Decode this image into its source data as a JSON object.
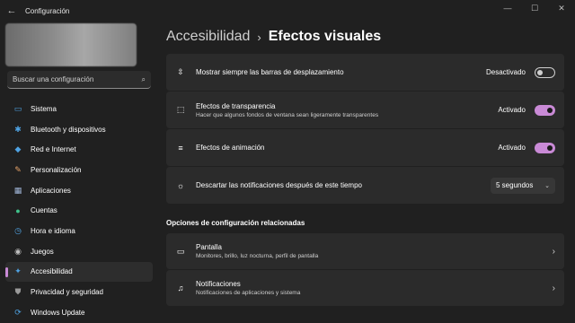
{
  "window": {
    "title": "Configuración",
    "back_glyph": "←",
    "controls": {
      "minimize": "—",
      "maximize": "☐",
      "close": "✕"
    }
  },
  "search": {
    "placeholder": "Buscar una configuración",
    "icon": "search-icon",
    "icon_glyph": "⌕"
  },
  "sidebar": {
    "items": [
      {
        "label": "Sistema",
        "icon": "monitor-icon",
        "glyph": "▭",
        "color": "#4fa3e3"
      },
      {
        "label": "Bluetooth y dispositivos",
        "icon": "bluetooth-icon",
        "glyph": "✱",
        "color": "#4fa3e3"
      },
      {
        "label": "Red e Internet",
        "icon": "wifi-icon",
        "glyph": "◆",
        "color": "#4fa3e3"
      },
      {
        "label": "Personalización",
        "icon": "brush-icon",
        "glyph": "✎",
        "color": "#e8a46a"
      },
      {
        "label": "Aplicaciones",
        "icon": "apps-icon",
        "glyph": "▦",
        "color": "#9fb4d6"
      },
      {
        "label": "Cuentas",
        "icon": "account-icon",
        "glyph": "●",
        "color": "#3fc38b"
      },
      {
        "label": "Hora e idioma",
        "icon": "globe-clock-icon",
        "glyph": "◷",
        "color": "#4fa3e3"
      },
      {
        "label": "Juegos",
        "icon": "gamepad-icon",
        "glyph": "◉",
        "color": "#bdbdbd"
      },
      {
        "label": "Accesibilidad",
        "icon": "accessibility-icon",
        "glyph": "✦",
        "color": "#4fa3e3",
        "active": true
      },
      {
        "label": "Privacidad y seguridad",
        "icon": "shield-icon",
        "glyph": "⛊",
        "color": "#9a9a9a"
      },
      {
        "label": "Windows Update",
        "icon": "update-icon",
        "glyph": "⟳",
        "color": "#4fa3e3"
      }
    ]
  },
  "breadcrumb": {
    "parent": "Accesibilidad",
    "separator": "›",
    "current": "Efectos visuales"
  },
  "settings": {
    "scrollbars": {
      "title": "Mostrar siempre las barras de desplazamiento",
      "state_label": "Desactivado",
      "on": false,
      "icon": "scrollbar-icon",
      "glyph": "⇳"
    },
    "transparency": {
      "title": "Efectos de transparencia",
      "subtitle": "Hacer que algunos fondos de ventana sean ligeramente transparentes",
      "state_label": "Activado",
      "on": true,
      "icon": "transparency-icon",
      "glyph": "⬚"
    },
    "animation": {
      "title": "Efectos de animación",
      "state_label": "Activado",
      "on": true,
      "icon": "animation-icon",
      "glyph": "≡"
    },
    "notifications_timeout": {
      "title": "Descartar las notificaciones después de este tiempo",
      "value": "5 segundos",
      "icon": "brightness-icon",
      "glyph": "☼"
    }
  },
  "related": {
    "heading": "Opciones de configuración relacionadas",
    "items": [
      {
        "title": "Pantalla",
        "subtitle": "Monitores, brillo, luz nocturna, perfil de pantalla",
        "icon": "display-icon",
        "glyph": "▭"
      },
      {
        "title": "Notificaciones",
        "subtitle": "Notificaciones de aplicaciones y sistema",
        "icon": "bell-icon",
        "glyph": "♫"
      }
    ]
  },
  "colors": {
    "accent": "#c98ad6",
    "background": "#202020",
    "card": "#2b2b2b"
  }
}
